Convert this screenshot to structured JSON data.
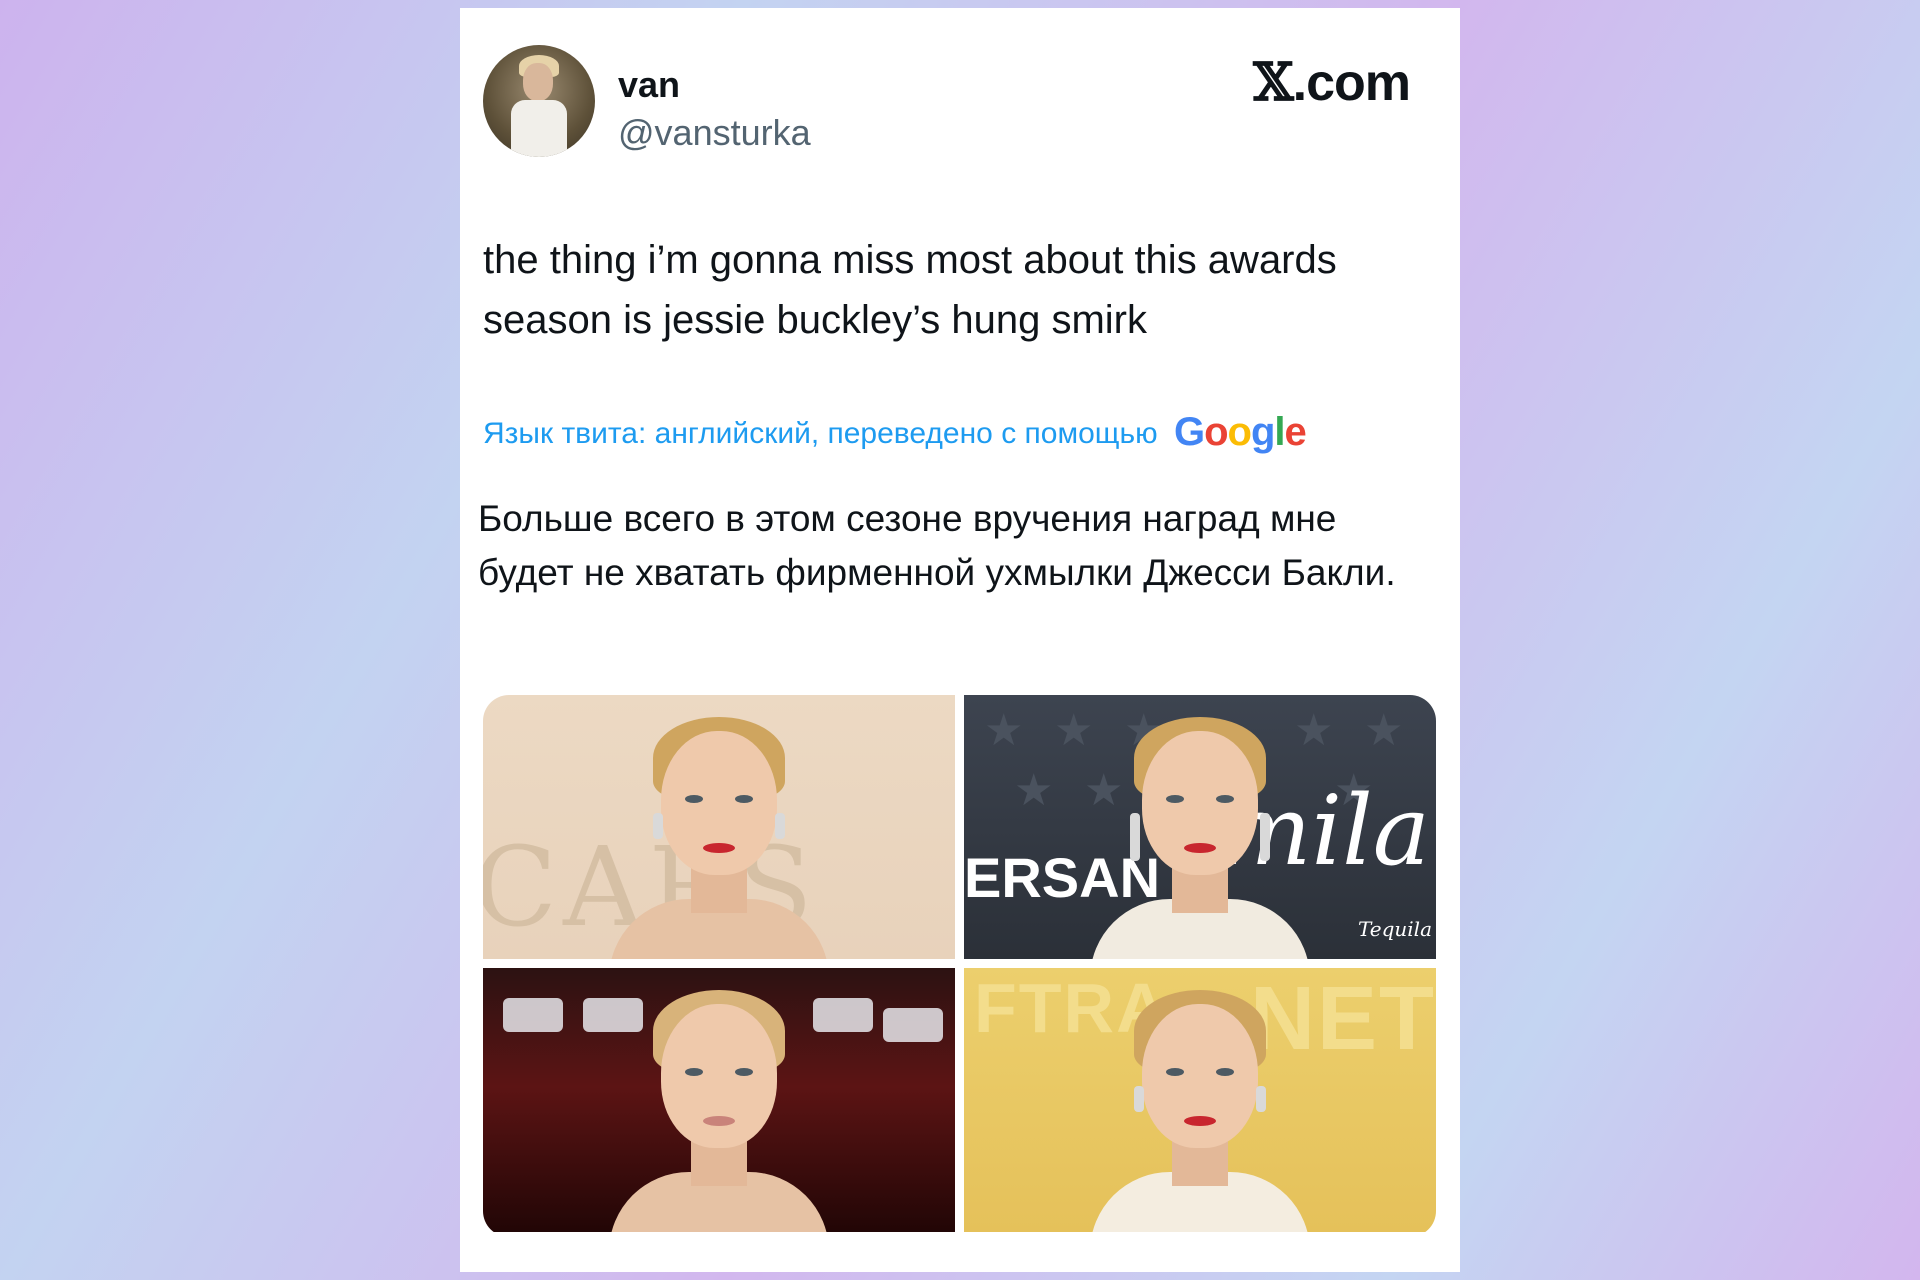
{
  "tweet": {
    "author_name": "van",
    "author_handle": "@vansturka",
    "brand": {
      "x_glyph": "𝕏",
      "domain": ".com"
    },
    "text": "the thing i’m gonna miss most about this awards season is jessie buckley’s hung smirk",
    "translation_notice": "Язык твита: английский, переведено с помощью",
    "translation_provider": "Google",
    "translation": "Больше всего в этом сезоне вручения наград мне будет не хватать фирменной ухмылки Джесси Бакли.",
    "photos": [
      {
        "backdrop_text": "CARS"
      },
      {
        "backdrop_text": "ERSAN",
        "backdrop_text_2": "mila",
        "backdrop_text_3": "Tequila"
      },
      {
        "backdrop_text": ""
      },
      {
        "backdrop_text": "FTRA",
        "backdrop_text_2": "NET"
      }
    ]
  },
  "colors": {
    "link_blue": "#1d9bf0",
    "text_primary": "#0f1419",
    "text_secondary": "#536471"
  }
}
